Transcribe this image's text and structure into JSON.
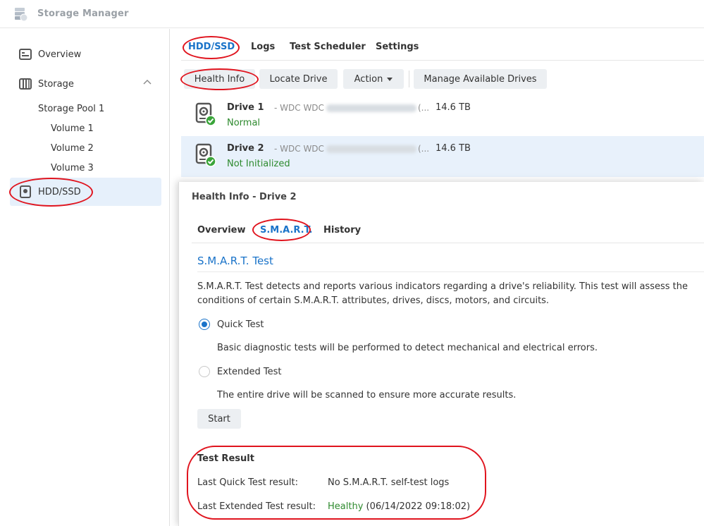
{
  "app": {
    "title": "Storage Manager",
    "icon": "storage-manager-icon"
  },
  "sidebar": {
    "items": [
      {
        "label": "Overview",
        "icon": "overview-icon"
      },
      {
        "label": "Storage",
        "icon": "storage-icon"
      },
      {
        "label": "HDD/SSD",
        "icon": "hdd-icon"
      }
    ],
    "sub_items": [
      "Storage Pool 1",
      "Volume 1",
      "Volume 2",
      "Volume 3"
    ]
  },
  "tabs": [
    "HDD/SSD",
    "Logs",
    "Test Scheduler",
    "Settings"
  ],
  "toolbar": {
    "health_info": "Health Info",
    "locate_drive": "Locate Drive",
    "action": "Action",
    "manage_drives": "Manage Available Drives"
  },
  "drives": [
    {
      "name": "Drive 1",
      "model": "- WDC WDC",
      "ellipsis": "(...",
      "size": "14.6 TB",
      "status": "Normal"
    },
    {
      "name": "Drive 2",
      "model": "- WDC WDC",
      "ellipsis": "(...",
      "size": "14.6 TB",
      "status": "Not Initialized"
    }
  ],
  "dialog": {
    "title": "Health Info - Drive 2",
    "tabs": [
      "Overview",
      "S.M.A.R.T.",
      "History"
    ],
    "section_title": "S.M.A.R.T. Test",
    "description_line1": "S.M.A.R.T. Test detects and reports various indicators regarding a drive's reliability. This test will assess the",
    "description_line2": "conditions of certain S.M.A.R.T. attributes, drives, discs, motors, and circuits.",
    "quick_test": {
      "label": "Quick Test",
      "desc": "Basic diagnostic tests will be performed to detect mechanical and electrical errors.",
      "checked": true
    },
    "extended_test": {
      "label": "Extended Test",
      "desc": "The entire drive will be scanned to ensure more accurate results.",
      "checked": false
    },
    "start_button": "Start",
    "result": {
      "title": "Test Result",
      "quick_label": "Last Quick Test result:",
      "quick_value": "No S.M.A.R.T. self-test logs",
      "extended_label": "Last Extended Test result:",
      "extended_status": "Healthy",
      "extended_date": "(06/14/2022 09:18:02)"
    }
  },
  "colors": {
    "accent": "#1a73c9",
    "healthy": "#2e8a2e",
    "annotation": "#e0141e",
    "selected_bg": "#e8f1fb"
  }
}
